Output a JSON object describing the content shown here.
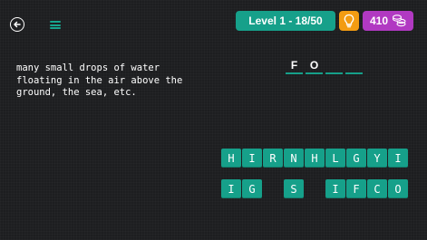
{
  "header": {
    "level_label": "Level 1 - 18/50",
    "coins": "410"
  },
  "icons": {
    "back": "arrow-left-circle",
    "menu": "hamburger",
    "hint": "lightbulb",
    "coins": "coin-stack"
  },
  "clue": "many small drops of water\nfloating in the air above the\nground, the sea, etc.",
  "answer": [
    "F",
    "O",
    "",
    ""
  ],
  "tiles_row1": [
    "H",
    "I",
    "R",
    "N",
    "H",
    "L",
    "G",
    "Y",
    "I"
  ],
  "tiles_row2": [
    "I",
    "G",
    "",
    "S",
    "",
    "I",
    "F",
    "C",
    "O"
  ],
  "colors": {
    "accent": "#16a08a",
    "hint": "#f39c12",
    "coins": "#b139c2",
    "background": "#1d1e20"
  }
}
